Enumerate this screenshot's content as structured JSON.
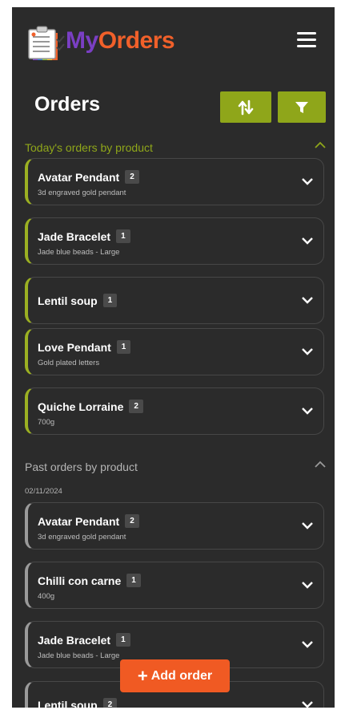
{
  "app": {
    "brand_my": "My",
    "brand_orders": "Orders"
  },
  "page": {
    "title": "Orders"
  },
  "colors": {
    "accent_green": "#8fa61a",
    "brand_purple": "#7a3fc4",
    "brand_orange": "#f1602a",
    "background": "#2b2b2b"
  },
  "today": {
    "heading": "Today's orders by product",
    "items": [
      {
        "name": "Avatar Pendant",
        "qty": "2",
        "desc": "3d engraved gold pendant"
      },
      {
        "name": "Jade Bracelet",
        "qty": "1",
        "desc": "Jade blue beads - Large"
      },
      {
        "name": "Lentil soup",
        "qty": "1",
        "desc": ""
      },
      {
        "name": "Love Pendant",
        "qty": "1",
        "desc": "Gold plated letters"
      },
      {
        "name": "Quiche Lorraine",
        "qty": "2",
        "desc": "700g"
      }
    ]
  },
  "past": {
    "heading": "Past orders by product",
    "date": "02/11/2024",
    "items": [
      {
        "name": "Avatar Pendant",
        "qty": "2",
        "desc": "3d engraved gold pendant"
      },
      {
        "name": "Chilli con carne",
        "qty": "1",
        "desc": "400g"
      },
      {
        "name": "Jade Bracelet",
        "qty": "1",
        "desc": "Jade blue beads - Large"
      },
      {
        "name": "Lentil soup",
        "qty": "2",
        "desc": ""
      }
    ]
  },
  "actions": {
    "add_order_label": "Add order",
    "add_order_icon": "+"
  },
  "icons": {
    "menu": "hamburger-icon",
    "sort": "sort-arrows-icon",
    "filter": "filter-funnel-icon",
    "expand": "chevron-down-icon",
    "collapse": "chevron-up-icon"
  }
}
